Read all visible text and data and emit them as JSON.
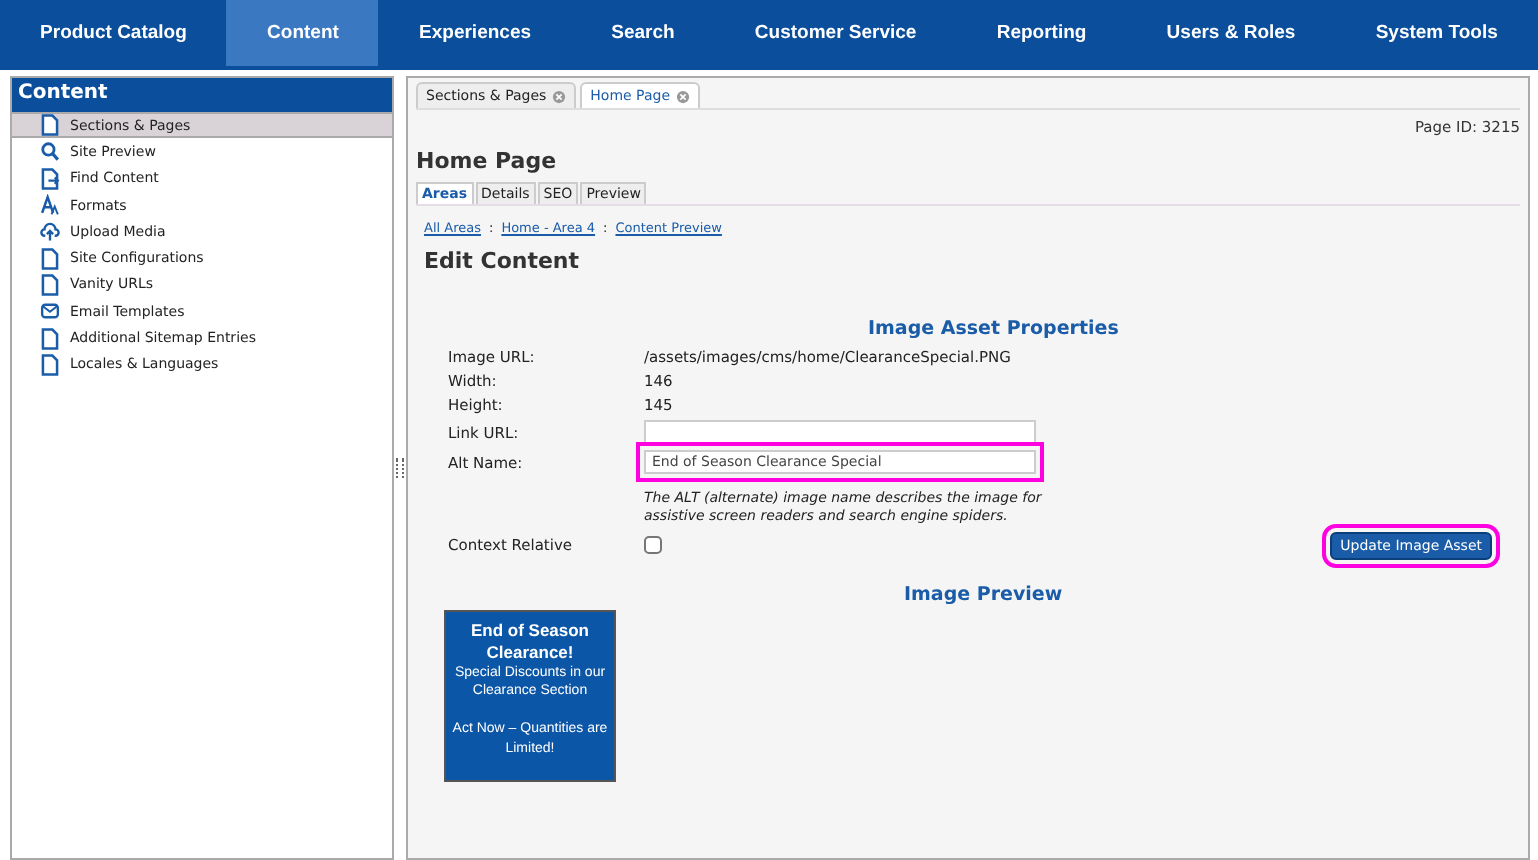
{
  "nav": [
    {
      "label": "Product Catalog",
      "selected": false
    },
    {
      "label": "Content",
      "selected": true
    },
    {
      "label": "Experiences",
      "selected": false
    },
    {
      "label": "Search",
      "selected": false
    },
    {
      "label": "Customer Service",
      "selected": false
    },
    {
      "label": "Reporting",
      "selected": false
    },
    {
      "label": "Users & Roles",
      "selected": false
    },
    {
      "label": "System Tools",
      "selected": false
    }
  ],
  "sidebar": {
    "title": "Content",
    "items": [
      {
        "label": "Sections & Pages",
        "kind": "page",
        "selected": true
      },
      {
        "label": "Site Preview",
        "kind": "search",
        "selected": false
      },
      {
        "label": "Find Content",
        "kind": "find",
        "selected": false
      },
      {
        "label": "Formats",
        "kind": "formats",
        "selected": false
      },
      {
        "label": "Upload Media",
        "kind": "upload",
        "selected": false
      },
      {
        "label": "Site Configurations",
        "kind": "page",
        "selected": false
      },
      {
        "label": "Vanity URLs",
        "kind": "page",
        "selected": false
      },
      {
        "label": "Email Templates",
        "kind": "email",
        "selected": false
      },
      {
        "label": "Additional Sitemap Entries",
        "kind": "page",
        "selected": false
      },
      {
        "label": "Locales & Languages",
        "kind": "page",
        "selected": false
      }
    ]
  },
  "doc_tabs": [
    {
      "label": "Sections & Pages",
      "selected": false
    },
    {
      "label": "Home Page",
      "selected": true
    }
  ],
  "page_id": "Page ID: 3215",
  "page_title": "Home Page",
  "sub_tabs": [
    {
      "label": "Areas",
      "selected": true
    },
    {
      "label": "Details",
      "selected": false
    },
    {
      "label": "SEO",
      "selected": false
    },
    {
      "label": "Preview",
      "selected": false
    }
  ],
  "breadcrumb": [
    "All Areas",
    "Home - Area 4",
    "Content Preview"
  ],
  "breadcrumb_separator": ":",
  "heading": "Edit Content",
  "properties": {
    "title": "Image Asset Properties",
    "rows": [
      {
        "label": "Image URL:",
        "kind": "text",
        "value": "/assets/images/cms/home/ClearanceSpecial.PNG"
      },
      {
        "label": "Width:",
        "kind": "text",
        "value": "146"
      },
      {
        "label": "Height:",
        "kind": "text",
        "value": "145"
      },
      {
        "label": "Link URL:",
        "kind": "input",
        "value": "",
        "highlighted": false
      },
      {
        "label": "Alt Name:",
        "kind": "input",
        "value": "End of Season Clearance Special",
        "highlighted": true,
        "help": "The ALT (alternate) image name describes the image for assistive screen readers and search engine spiders."
      },
      {
        "label": "Context Relative",
        "kind": "checkbox",
        "checked": false
      }
    ]
  },
  "update_button": {
    "label": "Update Image Asset",
    "highlighted": true
  },
  "preview": {
    "title": "Image Preview",
    "banner": [
      "End of Season Clearance!",
      "Special Discounts in our Clearance Section",
      "Act Now – Quantities are Limited!"
    ]
  }
}
